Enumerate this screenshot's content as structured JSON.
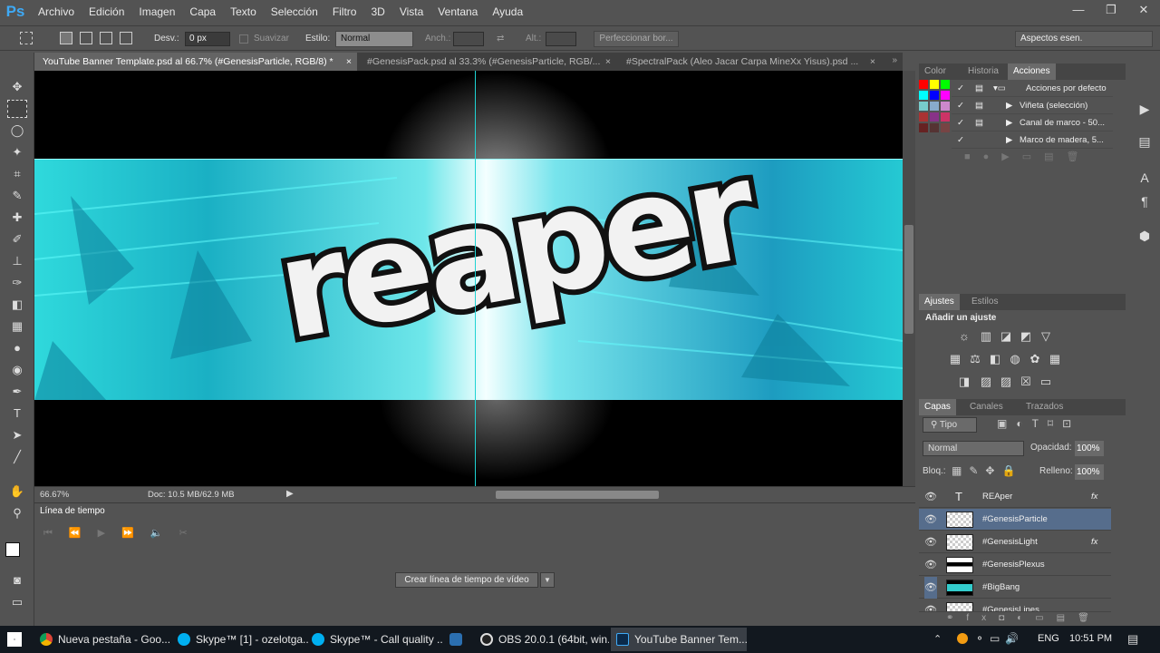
{
  "app": {
    "logo": "Ps"
  },
  "menu": [
    "Archivo",
    "Edición",
    "Imagen",
    "Capa",
    "Texto",
    "Selección",
    "Filtro",
    "3D",
    "Vista",
    "Ventana",
    "Ayuda"
  ],
  "options": {
    "feather_label": "Desv.:",
    "feather_value": "0 px",
    "smooth_label": "Suavizar",
    "style_label": "Estilo:",
    "style_value": "Normal",
    "width_label": "Anch.:",
    "height_label": "Alt.:",
    "refine_button": "Perfeccionar bor...",
    "workspace": "Aspectos esen."
  },
  "doc_tabs": [
    {
      "label": "YouTube Banner Template.psd al 66.7% (#GenesisParticle, RGB/8) *",
      "close": "×"
    },
    {
      "label": "#GenesisPack.psd al 33.3% (#GenesisParticle, RGB/...",
      "close": "×"
    },
    {
      "label": "#SpectralPack (Aleo Jacar Carpa MineXx Yisus).psd ...",
      "close": "×"
    }
  ],
  "canvas": {
    "text": "reaper"
  },
  "status": {
    "zoom": "66.67%",
    "doc": "Doc: 10.5 MB/62.9 MB"
  },
  "timeline": {
    "title": "Línea de tiempo",
    "create_button": "Crear línea de tiempo de vídeo"
  },
  "actions_panel": {
    "tabs": [
      "Color",
      "Historia",
      "Acciones"
    ],
    "items": [
      {
        "label": "Acciones por defecto"
      },
      {
        "label": "Viñeta (selección)"
      },
      {
        "label": "Canal de marco - 50..."
      },
      {
        "label": "Marco de madera, 5..."
      }
    ]
  },
  "adjust_panel": {
    "tabs": [
      "Ajustes",
      "Estilos"
    ],
    "title": "Añadir un ajuste"
  },
  "layers_panel": {
    "tabs": [
      "Capas",
      "Canales",
      "Trazados"
    ],
    "filter": "Tipo",
    "blend": "Normal",
    "opacity_label": "Opacidad:",
    "opacity": "100%",
    "lock_label": "Bloq.:",
    "fill_label": "Relleno:",
    "fill": "100%",
    "layers": [
      {
        "name": "REAper",
        "fx": "fx"
      },
      {
        "name": "#GenesisParticle",
        "fx": ""
      },
      {
        "name": "#GenesisLight",
        "fx": "fx"
      },
      {
        "name": "#GenesisPlexus",
        "fx": ""
      },
      {
        "name": "#BigBang",
        "fx": ""
      },
      {
        "name": "#GenesisLines",
        "fx": ""
      }
    ]
  },
  "taskbar": {
    "items": [
      {
        "label": "Nueva pestaña - Goo..."
      },
      {
        "label": "Skype™ [1] - ozelotga..."
      },
      {
        "label": "Skype™ - Call quality ..."
      },
      {
        "label": ""
      },
      {
        "label": "OBS 20.0.1 (64bit, win..."
      },
      {
        "label": "YouTube Banner Tem..."
      }
    ],
    "lang": "ENG",
    "time": "10:51 PM"
  },
  "colors": {
    "accent": "#3ea9f5",
    "selected_layer": "#566d8c",
    "cyan": "#2ee6e6"
  }
}
